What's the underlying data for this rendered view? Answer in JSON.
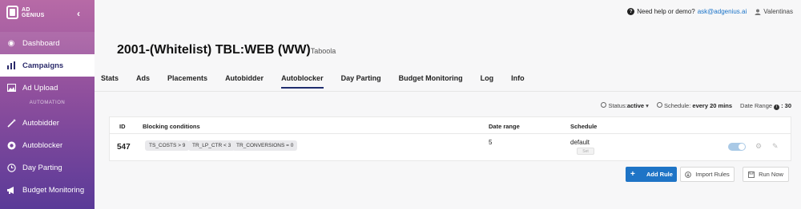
{
  "brand": {
    "line1": "AD",
    "line2": "GENIUS"
  },
  "sidebar": {
    "collapse_icon": "chevron-left-icon",
    "items": [
      {
        "label": "Dashboard",
        "icon": "dashboard-icon"
      },
      {
        "label": "Campaigns",
        "icon": "bar-chart-icon"
      },
      {
        "label": "Ad Upload",
        "icon": "image-icon"
      },
      {
        "label": "Autobidder",
        "icon": "magic-wand-icon"
      },
      {
        "label": "Autoblocker",
        "icon": "block-icon"
      },
      {
        "label": "Day Parting",
        "icon": "clock-icon"
      },
      {
        "label": "Budget Monitoring",
        "icon": "megaphone-icon"
      }
    ],
    "section_label": "AUTOMATION"
  },
  "topbar": {
    "help_text": "Need help or demo?",
    "email": "ask@adgenius.ai",
    "user": "Valentinas"
  },
  "page": {
    "title": "2001-(Whitelist) TBL:WEB (WW)",
    "subtitle": "Taboola"
  },
  "tabs": [
    "Stats",
    "Ads",
    "Placements",
    "Autobidder",
    "Autoblocker",
    "Day Parting",
    "Budget Monitoring",
    "Log",
    "Info"
  ],
  "active_tab": "Autoblocker",
  "status_bar": {
    "status_label": "Status:",
    "status_value": "active",
    "schedule_label": "Schedule:",
    "schedule_value": "every 20 mins",
    "date_range_label": "Date Range",
    "date_range_value": ": 30"
  },
  "table": {
    "headers": {
      "id": "ID",
      "conditions": "Blocking conditions",
      "date_range": "Date range",
      "schedule": "Schedule"
    },
    "rows": [
      {
        "id": "547",
        "conditions": [
          "TS_COSTS > 9",
          "TR_LP_CTR < 3",
          "TR_CONVERSIONS = 0"
        ],
        "date_range": "5",
        "schedule": "default",
        "schedule_button": "Set",
        "enabled": true
      }
    ]
  },
  "buttons": {
    "add_rule": "Add Rule",
    "import_rules": "Import Rules",
    "run_now": "Run Now"
  },
  "colors": {
    "accent": "#1e74c6",
    "sidebar_top": "#b76aa6",
    "sidebar_bottom": "#5a3a98"
  }
}
